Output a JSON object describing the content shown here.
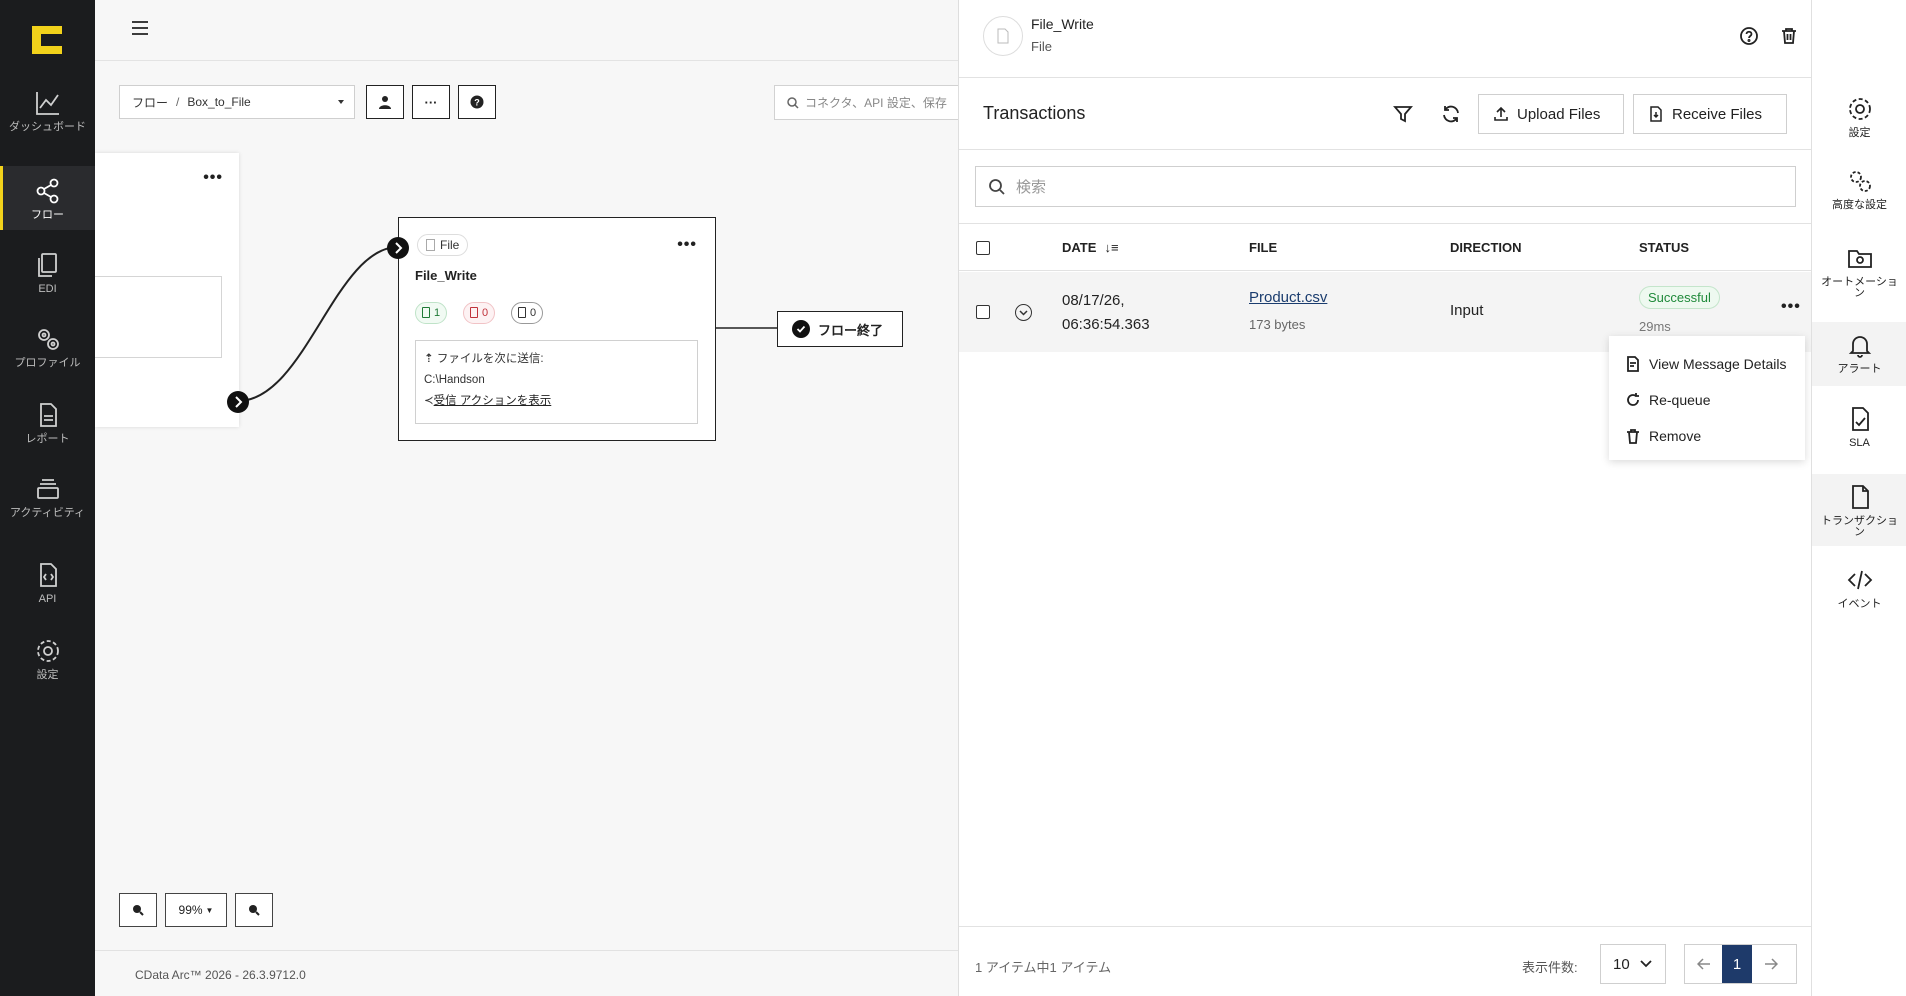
{
  "nav": {
    "items": [
      {
        "label": "ダッシュボード"
      },
      {
        "label": "フロー"
      },
      {
        "label": "EDI"
      },
      {
        "label": "プロファイル"
      },
      {
        "label": "レポート"
      },
      {
        "label": "アクティビティ"
      },
      {
        "label": "API"
      },
      {
        "label": "設定"
      }
    ]
  },
  "toolbar": {
    "breadcrumb_root": "フロー",
    "breadcrumb_sep": "/",
    "breadcrumb_flow": "Box_to_File",
    "search_placeholder": "コネクタ、API 設定、保存",
    "more_label": "···"
  },
  "canvas": {
    "node": {
      "type_label": "File",
      "title": "File_Write",
      "badge_success": "1",
      "badge_error": "0",
      "badge_pending": "0",
      "send_label": "ファイルを次に送信:",
      "send_target": "C:\\Handson",
      "receive_link": "受信 アクションを表示"
    },
    "end_node": "フロー終了",
    "zoom_level": "99%",
    "version": "CData Arc™ 2026 - 26.3.9712.0"
  },
  "panel": {
    "title": "File_Write",
    "subtitle": "File",
    "transactions_title": "Transactions",
    "upload_label": "Upload Files",
    "receive_label": "Receive Files",
    "search_placeholder": "検索",
    "columns": {
      "date": "DATE",
      "file": "FILE",
      "direction": "DIRECTION",
      "status": "STATUS"
    },
    "rows": [
      {
        "date_line1": "08/17/26,",
        "date_line2": "06:36:54.363",
        "file": "Product.csv",
        "size": "173 bytes",
        "direction": "Input",
        "status": "Successful",
        "duration": "29ms"
      }
    ],
    "context_menu": [
      {
        "label": "View Message Details"
      },
      {
        "label": "Re-queue"
      },
      {
        "label": "Remove"
      }
    ],
    "footer": {
      "count_text": "1 アイテム中1 アイテム",
      "per_page_label": "表示件数:",
      "per_page_value": "10",
      "current_page": "1"
    }
  },
  "rail": {
    "items": [
      {
        "label": "設定"
      },
      {
        "label": "高度な設定"
      },
      {
        "label": "オートメーション"
      },
      {
        "label": "アラート"
      },
      {
        "label": "SLA"
      },
      {
        "label": "トランザクション"
      },
      {
        "label": "イベント"
      }
    ]
  },
  "colors": {
    "brand": "#f2d21b",
    "nav_bg": "#1b1c1e",
    "success": "#1f8a3a",
    "error": "#c0323b",
    "pager_active": "#1e3a6a"
  }
}
